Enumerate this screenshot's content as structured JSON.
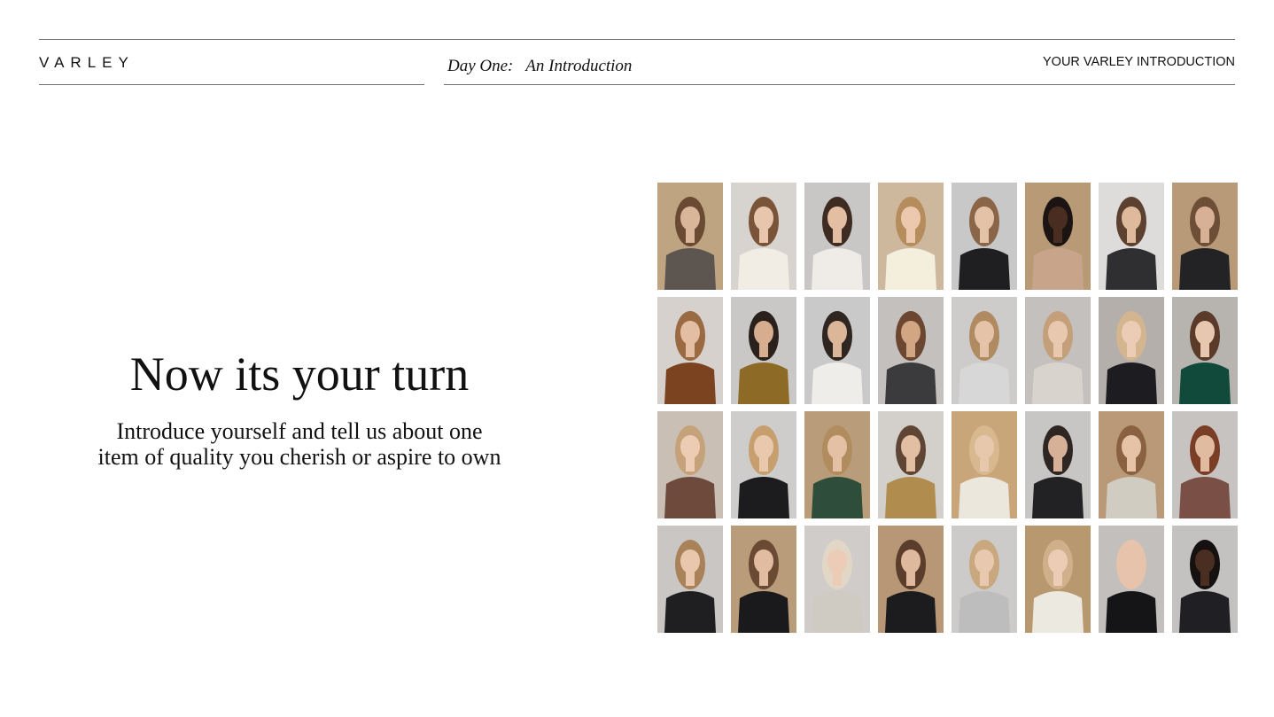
{
  "header": {
    "brand": "VARLEY",
    "subtitle": "Day One:   An Introduction",
    "tag": "YOUR VARLEY INTRODUCTION"
  },
  "main": {
    "headline": "Now its your turn",
    "body": "Introduce yourself and tell us about one item of quality you cherish or aspire to own"
  },
  "gallery": {
    "photos": [
      {
        "bg": "#bfa482",
        "skin": "#d9b59a",
        "hair": "#6b4a33",
        "top": "#5c5550"
      },
      {
        "bg": "#d7d3cf",
        "skin": "#e8c6ad",
        "hair": "#7a5438",
        "top": "#f1ece4"
      },
      {
        "bg": "#c9c7c6",
        "skin": "#e3bea3",
        "hair": "#3e2c22",
        "top": "#efece7"
      },
      {
        "bg": "#cdb89d",
        "skin": "#ecc9ae",
        "hair": "#b58c5c",
        "top": "#f4eedd"
      },
      {
        "bg": "#c9c8c8",
        "skin": "#e4c2a8",
        "hair": "#8a6547",
        "top": "#1f1f22"
      },
      {
        "bg": "#b89a77",
        "skin": "#4a2d21",
        "hair": "#1b1412",
        "top": "#c8a58a"
      },
      {
        "bg": "#dedcdb",
        "skin": "#dfb99b",
        "hair": "#5c4030",
        "top": "#2f2f31"
      },
      {
        "bg": "#b89a78",
        "skin": "#d7b096",
        "hair": "#6d4f38",
        "top": "#232325"
      },
      {
        "bg": "#d6d1cc",
        "skin": "#e4bea2",
        "hair": "#9a6a43",
        "top": "#7c4320"
      },
      {
        "bg": "#c9c8c6",
        "skin": "#d6ad8e",
        "hair": "#2b211c",
        "top": "#8d6a26"
      },
      {
        "bg": "#c9c9c9",
        "skin": "#dcb699",
        "hair": "#2f2621",
        "top": "#efede9"
      },
      {
        "bg": "#c4c0bd",
        "skin": "#d2a583",
        "hair": "#6b4630",
        "top": "#3b3b3d"
      },
      {
        "bg": "#cdccca",
        "skin": "#e5c3a9",
        "hair": "#b08b61",
        "top": "#d7d7d7"
      },
      {
        "bg": "#c3c0bd",
        "skin": "#e8c8ae",
        "hair": "#c4a07a",
        "top": "#d8d3cd"
      },
      {
        "bg": "#b4afaa",
        "skin": "#ebcdb6",
        "hair": "#d3b58f",
        "top": "#1d1d21"
      },
      {
        "bg": "#b7b4b0",
        "skin": "#e8c7b0",
        "hair": "#5a3a28",
        "top": "#114a3b"
      },
      {
        "bg": "#c9bfb4",
        "skin": "#ecccb3",
        "hair": "#c6a27a",
        "top": "#6e4a3c"
      },
      {
        "bg": "#cfcdcc",
        "skin": "#e9c8ae",
        "hair": "#c79f6f",
        "top": "#1c1c1e"
      },
      {
        "bg": "#b99c79",
        "skin": "#e4c0a4",
        "hair": "#b18c5e",
        "top": "#2e4d3a"
      },
      {
        "bg": "#d3d0cc",
        "skin": "#e2bea2",
        "hair": "#5f4533",
        "top": "#b08c4e"
      },
      {
        "bg": "#c9a57a",
        "skin": "#e8c8ad",
        "hair": "#d8b88e",
        "top": "#ece7dc"
      },
      {
        "bg": "#c8c6c4",
        "skin": "#d7b197",
        "hair": "#2e2622",
        "top": "#222224"
      },
      {
        "bg": "#b99977",
        "skin": "#e6c3a6",
        "hair": "#8a6242",
        "top": "#d0ccc2"
      },
      {
        "bg": "#c7c3c0",
        "skin": "#e1bb9f",
        "hair": "#7a3e26",
        "top": "#7a5046"
      },
      {
        "bg": "#c9c6c3",
        "skin": "#e9c7ad",
        "hair": "#a98259",
        "top": "#1f1f22"
      },
      {
        "bg": "#b99d7b",
        "skin": "#e2bca1",
        "hair": "#6a4a33",
        "top": "#1a1a1c"
      },
      {
        "bg": "#cfccca",
        "skin": "#ecccb7",
        "hair": "#e2d7c6",
        "top": "#cfcac2"
      },
      {
        "bg": "#b89776",
        "skin": "#dfb99d",
        "hair": "#5a3d2b",
        "top": "#1c1c1f"
      },
      {
        "bg": "#cdcbc9",
        "skin": "#e8c8ae",
        "hair": "#c9a77f",
        "top": "#bdbdbd"
      },
      {
        "bg": "#b8986f",
        "skin": "#ecccb4",
        "hair": "#d0b08a",
        "top": "#ece9e0"
      },
      {
        "bg": "#c2bfbc",
        "skin": "#e6c3aa",
        "hair": "#e6c3aa",
        "top": "#151517"
      },
      {
        "bg": "#c4c2c1",
        "skin": "#4a2e22",
        "hair": "#151110",
        "top": "#202024"
      }
    ]
  }
}
